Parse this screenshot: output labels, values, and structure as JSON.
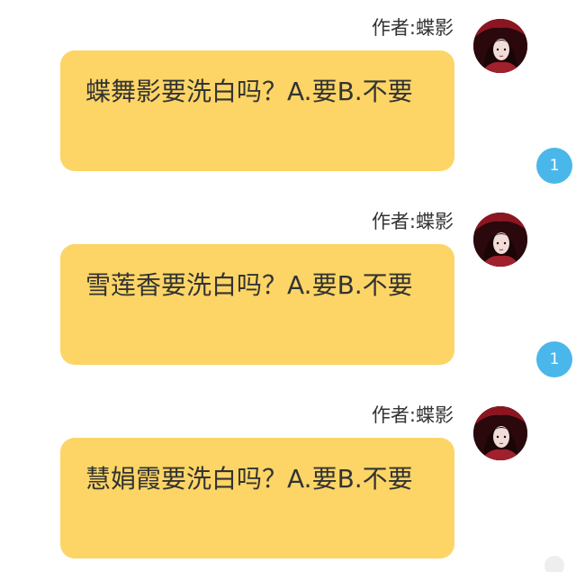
{
  "messages": [
    {
      "author": "作者:蝶影",
      "text": "蝶舞影要洗白吗？A.要B.不要",
      "badge": "1"
    },
    {
      "author": "作者:蝶影",
      "text": "雪莲香要洗白吗？A.要B.不要",
      "badge": "1"
    },
    {
      "author": "作者:蝶影",
      "text": "慧娟霞要洗白吗？A.要B.不要",
      "badge": ""
    }
  ],
  "colors": {
    "bubble": "#fcd566",
    "badge": "#4ab7eb",
    "text": "#333333"
  }
}
